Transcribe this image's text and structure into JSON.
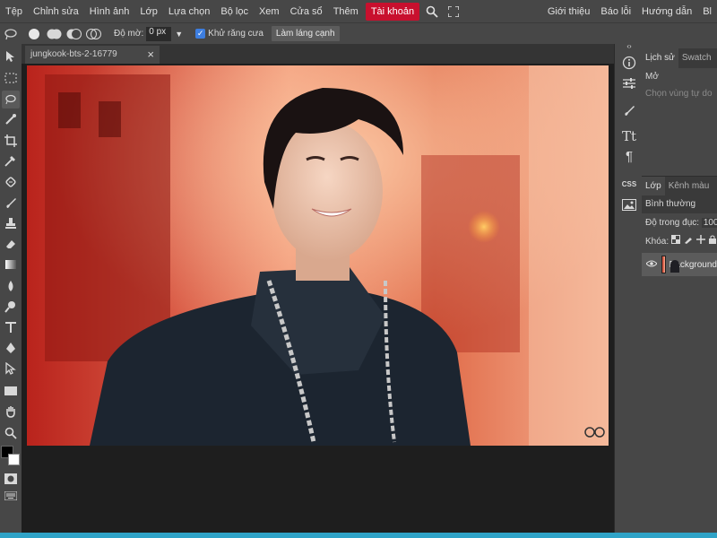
{
  "menubar": {
    "items": [
      "Tệp",
      "Chỉnh sửa",
      "Hình ảnh",
      "Lớp",
      "Lựa chọn",
      "Bộ lọc",
      "Xem",
      "Cửa sổ",
      "Thêm"
    ],
    "account": "Tài khoản",
    "right_items": [
      "Giới thiệu",
      "Báo lỗi",
      "Hướng dẫn",
      "Bl"
    ],
    "icons": [
      "search-icon",
      "fullscreen-icon"
    ]
  },
  "options": {
    "feather_label": "Độ mờ:",
    "feather_value": "0 px",
    "antialias_checked": true,
    "antialias_label": "Khử răng cưa",
    "refine_edge_button": "Làm láng cạnh"
  },
  "document": {
    "tab_title": "jungkook-bts-2-16779",
    "close_symbol": "×"
  },
  "iconcol": {
    "css_label": "CSS"
  },
  "panels": {
    "history_tabs": [
      "Lịch sử",
      "Swatch"
    ],
    "history_items": [
      "Mở",
      "Chọn vùng tự do"
    ],
    "layers_tabs": [
      "Lớp",
      "Kênh màu"
    ],
    "blend_mode": "Bình thường",
    "opacity_label": "Độ trong đục:",
    "opacity_value": "100",
    "lock_label": "Khóa:",
    "layer_name": "Background"
  },
  "colors": {
    "accent_red": "#c8102e",
    "bottom_bar": "#2fa3c7",
    "foreground": "#000000",
    "background": "#ffffff"
  }
}
